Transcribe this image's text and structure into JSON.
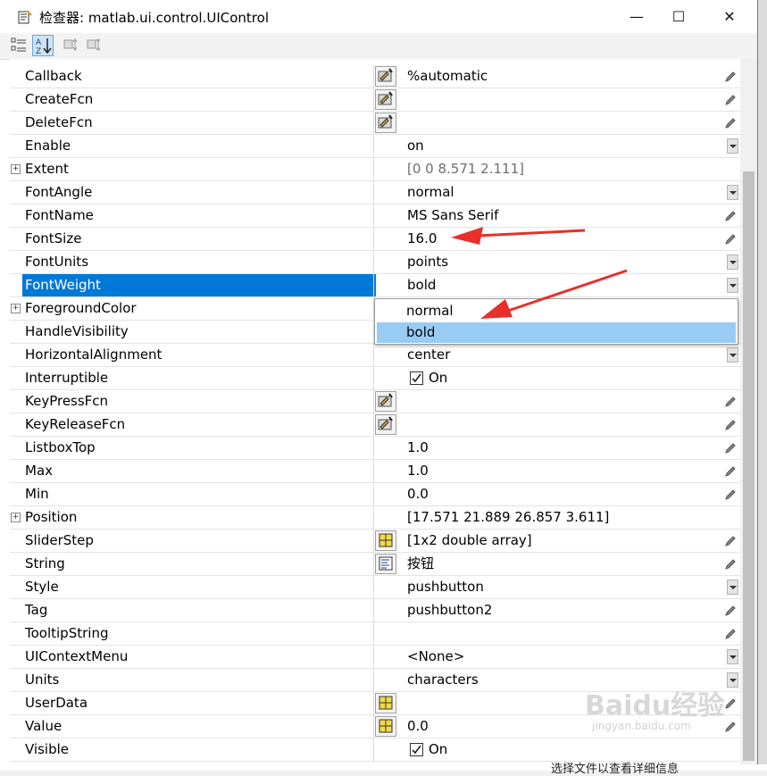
{
  "window": {
    "title": "检查器: matlab.ui.control.UIControl",
    "minimize": "—",
    "maximize": "☐",
    "close": "✕"
  },
  "toolbar": {
    "buttons": [
      "categorized-view",
      "alphabetical-view",
      "expand-all",
      "collapse-all"
    ],
    "active": "alphabetical-view"
  },
  "properties": [
    {
      "name": "Callback",
      "value": "%automatic",
      "editor": "callback",
      "control": "pencil"
    },
    {
      "name": "CreateFcn",
      "value": "",
      "editor": "callback",
      "control": "pencil"
    },
    {
      "name": "DeleteFcn",
      "value": "",
      "editor": "callback",
      "control": "pencil"
    },
    {
      "name": "Enable",
      "value": "on",
      "control": "dropdown"
    },
    {
      "name": "Extent",
      "value": "[0 0 8.571 2.111]",
      "expandable": true,
      "readonly": true
    },
    {
      "name": "FontAngle",
      "value": "normal",
      "control": "dropdown"
    },
    {
      "name": "FontName",
      "value": "MS Sans Serif",
      "control": "pencil"
    },
    {
      "name": "FontSize",
      "value": "16.0",
      "control": "pencil"
    },
    {
      "name": "FontUnits",
      "value": "points",
      "control": "dropdown"
    },
    {
      "name": "FontWeight",
      "value": "bold",
      "control": "dropdown",
      "selected": true
    },
    {
      "name": "ForegroundColor",
      "value": "",
      "expandable": true
    },
    {
      "name": "HandleVisibility",
      "value": "",
      "control": "dropdown"
    },
    {
      "name": "HorizontalAlignment",
      "value": "center",
      "control": "dropdown"
    },
    {
      "name": "Interruptible",
      "value": "On",
      "control": "checkbox"
    },
    {
      "name": "KeyPressFcn",
      "value": "",
      "editor": "callback",
      "control": "pencil"
    },
    {
      "name": "KeyReleaseFcn",
      "value": "",
      "editor": "callback",
      "control": "pencil"
    },
    {
      "name": "ListboxTop",
      "value": "1.0",
      "control": "pencil"
    },
    {
      "name": "Max",
      "value": "1.0",
      "control": "pencil"
    },
    {
      "name": "Min",
      "value": "0.0",
      "control": "pencil"
    },
    {
      "name": "Position",
      "value": "[17.571 21.889 26.857 3.611]",
      "expandable": true
    },
    {
      "name": "SliderStep",
      "value": "[1x2  double array]",
      "editor": "array",
      "control": "pencil"
    },
    {
      "name": "String",
      "value": "按钮",
      "editor": "text",
      "control": "pencil"
    },
    {
      "name": "Style",
      "value": "pushbutton",
      "control": "dropdown"
    },
    {
      "name": "Tag",
      "value": "pushbutton2",
      "control": "pencil"
    },
    {
      "name": "TooltipString",
      "value": "",
      "control": "pencil"
    },
    {
      "name": "UIContextMenu",
      "value": "<None>",
      "control": "dropdown"
    },
    {
      "name": "Units",
      "value": "characters",
      "control": "dropdown"
    },
    {
      "name": "UserData",
      "value": "",
      "editor": "array",
      "control": "pencil"
    },
    {
      "name": "Value",
      "value": "0.0",
      "editor": "array",
      "control": "pencil"
    },
    {
      "name": "Visible",
      "value": "On",
      "control": "checkbox"
    }
  ],
  "dropdown_popup": {
    "options": [
      "normal",
      "bold"
    ],
    "highlighted": "bold"
  },
  "watermark": {
    "text": "Baidu经验",
    "sub": "jingyan.baidu.com"
  },
  "background_text": "选择文件以查看详细信息",
  "colors": {
    "selection": "#0078d7",
    "popup_highlight": "#99ccf5",
    "annotation_arrow": "#e8302a"
  }
}
